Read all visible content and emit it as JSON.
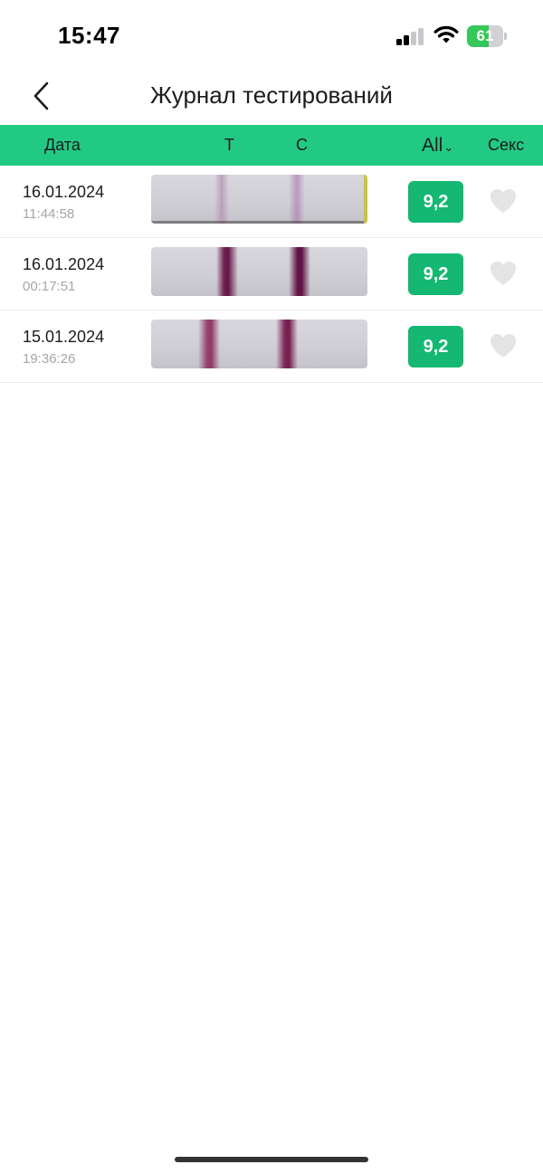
{
  "status_bar": {
    "time": "15:47",
    "signal_bars": 2,
    "signal_icon": "cellular-signal-icon",
    "wifi_icon": "wifi-icon",
    "battery_percent": "61",
    "battery_level": 0.61,
    "battery_icon": "battery-charging-icon"
  },
  "header": {
    "back_icon": "chevron-left-icon",
    "title": "Журнал тестирований"
  },
  "columns": {
    "date": "Дата",
    "t": "T",
    "c": "C",
    "filter": "All",
    "filter_icon": "chevron-down-icon",
    "sex": "Секс"
  },
  "rows": [
    {
      "date": "16.01.2024",
      "time": "11:44:58",
      "score": "9,2",
      "favorite": false
    },
    {
      "date": "16.01.2024",
      "time": "00:17:51",
      "score": "9,2",
      "favorite": false
    },
    {
      "date": "15.01.2024",
      "time": "19:36:26",
      "score": "9,2",
      "favorite": false
    }
  ],
  "colors": {
    "accent": "#22c983",
    "badge": "#14b872",
    "heart": "#e4e4e4",
    "strip_line": "#8b2a5e"
  }
}
